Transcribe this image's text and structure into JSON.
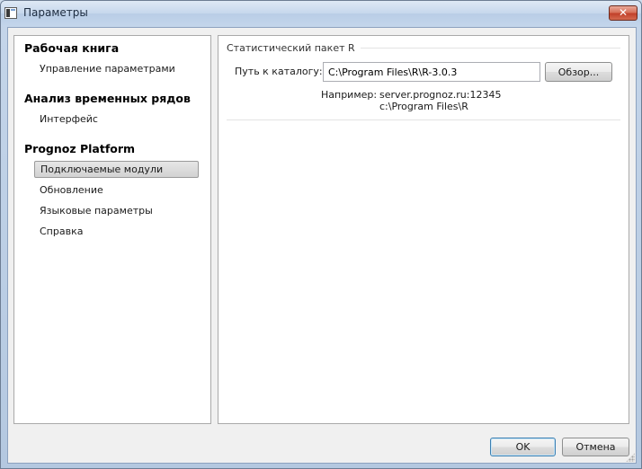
{
  "window": {
    "title": "Параметры",
    "close_glyph": "✕"
  },
  "sidebar": {
    "groups": [
      {
        "title": "Рабочая книга",
        "items": [
          {
            "label": "Управление параметрами",
            "selected": false
          }
        ]
      },
      {
        "title": "Анализ временных рядов",
        "items": [
          {
            "label": "Интерфейс",
            "selected": false
          }
        ]
      },
      {
        "title": "Prognoz Platform",
        "items": [
          {
            "label": "Подключаемые модули",
            "selected": true
          },
          {
            "label": "Обновление",
            "selected": false
          },
          {
            "label": "Языковые параметры",
            "selected": false
          },
          {
            "label": "Справка",
            "selected": false
          }
        ]
      }
    ]
  },
  "content": {
    "section_title": "Статистический пакет R",
    "path_label": "Путь к каталогу:",
    "path_value": "C:\\Program Files\\R\\R-3.0.3",
    "browse_label": "Обзор...",
    "example_label": "Например:",
    "example_lines": [
      "server.prognoz.ru:12345",
      "c:\\Program Files\\R"
    ]
  },
  "footer": {
    "ok_label": "OK",
    "cancel_label": "Отмена"
  },
  "icons": {
    "app": "app-window-icon",
    "close": "close-icon"
  },
  "colors": {
    "close_button": "#c2412a",
    "selection": "#d2d2d2",
    "default_button_border": "#3c7fb1"
  }
}
